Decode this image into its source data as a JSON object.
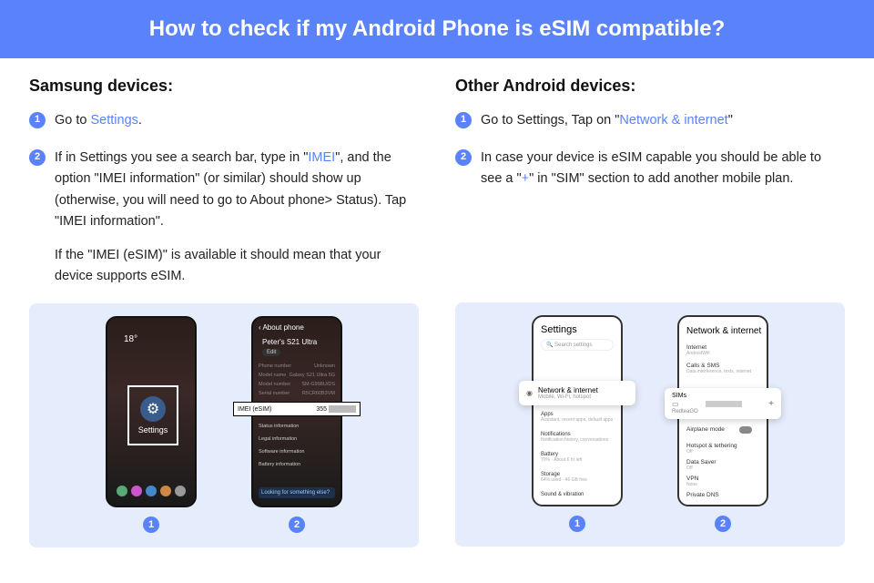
{
  "title": "How to check if my Android Phone is eSIM compatible?",
  "samsung": {
    "heading": "Samsung devices:",
    "step1_before": "Go to ",
    "step1_link": "Settings",
    "step1_after": ".",
    "step2_before": "If in Settings you see a search bar, type in \"",
    "step2_link": "IMEI",
    "step2_after": "\", and the option \"IMEI information\" (or similar) should show up (otherwise, you will need to go to About phone> Status). Tap \"IMEI information\".",
    "step2_extra": "If the \"IMEI (eSIM)\" is available it should mean that your device supports eSIM.",
    "shot1": {
      "weather": "18°",
      "label": "Settings",
      "badge": "1"
    },
    "shot2": {
      "header": "‹  About phone",
      "device": "Peter's S21 Ultra",
      "edit": "Edit",
      "r1l": "Phone number",
      "r1r": "Unknown",
      "r2l": "Model name",
      "r2r": "Galaxy S21 Ultra 5G",
      "r3l": "Model number",
      "r3r": "SM-G998U/DS",
      "r4l": "Serial number",
      "r4r": "R5CR60B3VM",
      "imei": "IMEI (eSIM)",
      "imei_num": "355",
      "l1": "Status information",
      "l2": "Legal information",
      "l3": "Software information",
      "l4": "Battery information",
      "tip": "Looking for something else?",
      "badge": "2"
    }
  },
  "other": {
    "heading": "Other Android devices:",
    "step1_before": "Go to Settings, Tap on \"",
    "step1_link": "Network & internet",
    "step1_after": "\"",
    "step2_before": "In case your device is eSIM capable you should be able to see a \"",
    "step2_link": "+",
    "step2_after": "\" in \"SIM\" section to add another mobile plan.",
    "shot1": {
      "title": "Settings",
      "search": "Search settings",
      "net": "Network & internet",
      "netsub": "Mobile, Wi-Fi, hotspot",
      "apps": "Apps",
      "appsSub": "Assistant, recent apps, default apps",
      "notif": "Notifications",
      "notifSub": "Notification history, conversations",
      "batt": "Battery",
      "battSub": "70% · About 6 hr left",
      "stor": "Storage",
      "storSub": "64% used · 46 GB free",
      "sound": "Sound & vibration",
      "badge": "1"
    },
    "shot2": {
      "title": "Network & internet",
      "inet": "Internet",
      "inetSub": "AndroidWifi",
      "calls": "Calls & SMS",
      "callsSub": "Data interference, texts, internet",
      "sims": "SIMs",
      "red": "RedteaGO",
      "plus": "+",
      "air": "Airplane mode",
      "hot": "Hotspot & tethering",
      "hotSub": "Off",
      "ds": "Data Saver",
      "dsSub": "Off",
      "vpn": "VPN",
      "vpnSub": "None",
      "pdns": "Private DNS",
      "badge": "2"
    }
  }
}
